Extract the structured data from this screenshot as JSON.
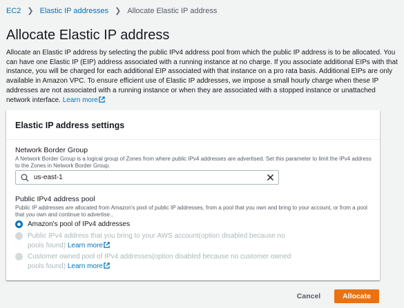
{
  "breadcrumb": {
    "items": [
      {
        "label": "EC2"
      },
      {
        "label": "Elastic IP addresses"
      },
      {
        "label": "Allocate Elastic IP address"
      }
    ]
  },
  "page": {
    "title": "Allocate Elastic IP address",
    "intro": "Allocate an Elastic IP address by selecting the public IPv4 address pool from which the public IP address is to be allocated. You can have one Elastic IP (EIP) address associated with a running instance at no charge. If you associate additional EIPs with that instance, you will be charged for each additional EIP associated with that instance on a pro rata basis. Additional EIPs are only available in Amazon VPC. To ensure efficient use of Elastic IP addresses, we impose a small hourly charge when these IP addresses are not associated with a running instance or when they are associated with a stopped instance or unattached network interface.",
    "learn_more": "Learn more"
  },
  "settings": {
    "header": "Elastic IP address settings",
    "network_border_group": {
      "label": "Network Border Group",
      "description": "A Network Border Group is a logical group of Zones from where public IPv4 addresses are advertised. Set this parameter to limit the IPv4 address to the Zones in Network Border Group.",
      "value": "us-east-1"
    },
    "pool": {
      "label": "Public IPv4 address pool",
      "description": "Public IP addresses are allocated from Amazon's pool of public IP addresses, from a pool that you own and bring to your account, or from a pool that you own and continue to advertise..",
      "options": [
        {
          "label": "Amazon's pool of IPv4 addresses",
          "selected": true,
          "disabled": false
        },
        {
          "label": "Public IPv4 address that you bring to your AWS account(option disabled because no pools found)",
          "link": "Learn more",
          "selected": false,
          "disabled": true
        },
        {
          "label": "Customer owned pool of IPv4 addresses(option disabled because no customer owned pools found)",
          "link": "Learn more",
          "selected": false,
          "disabled": true
        }
      ]
    }
  },
  "actions": {
    "cancel": "Cancel",
    "allocate": "Allocate"
  },
  "colors": {
    "link": "#0073bb",
    "primary": "#ec7211",
    "background": "#f2f3f3"
  }
}
